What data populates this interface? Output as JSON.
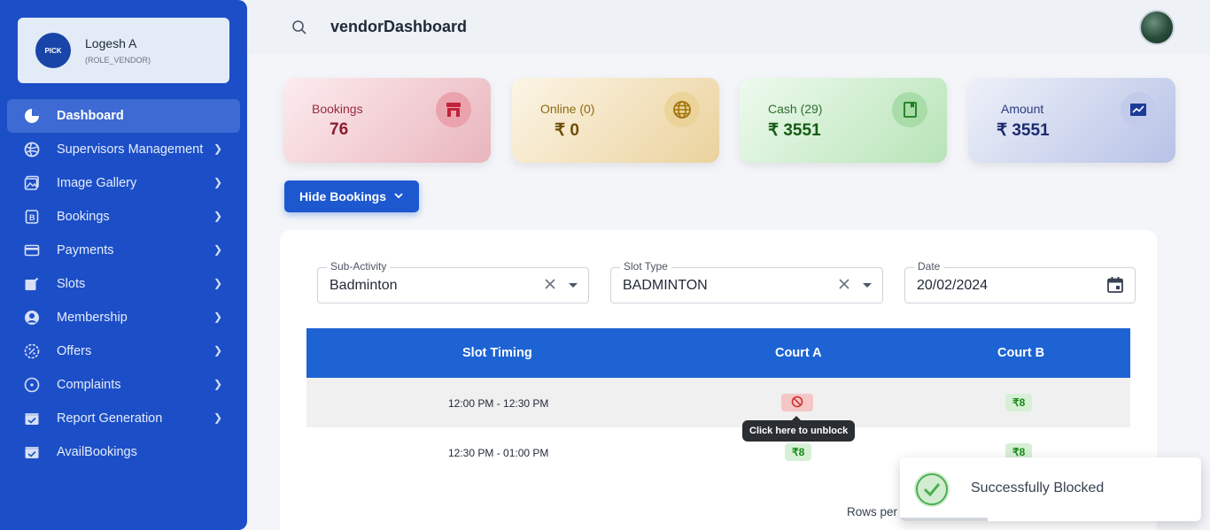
{
  "profile": {
    "name": "Logesh A",
    "role": "(ROLE_VENDOR)",
    "avatar_text": "PICK"
  },
  "nav": [
    {
      "label": "Dashboard",
      "icon": "pie-chart-icon",
      "active": true
    },
    {
      "label": "Supervisors Management",
      "icon": "globe-icon"
    },
    {
      "label": "Image Gallery",
      "icon": "gallery-icon"
    },
    {
      "label": "Bookings",
      "icon": "booking-icon"
    },
    {
      "label": "Payments",
      "icon": "card-icon"
    },
    {
      "label": "Slots",
      "icon": "edit-icon"
    },
    {
      "label": "Membership",
      "icon": "user-circle-icon"
    },
    {
      "label": "Offers",
      "icon": "offer-icon"
    },
    {
      "label": "Complaints",
      "icon": "dot-circle-icon"
    },
    {
      "label": "Report Generation",
      "icon": "calendar-check-icon"
    },
    {
      "label": "AvailBookings",
      "icon": "calendar-icon"
    }
  ],
  "header": {
    "title": "vendorDashboard"
  },
  "cards": [
    {
      "label": "Bookings",
      "value": "76",
      "icon": "store-icon"
    },
    {
      "label": "Online (0)",
      "value": "₹ 0",
      "icon": "globe-icon"
    },
    {
      "label": "Cash (29)",
      "value": "₹ 3551",
      "icon": "book-icon"
    },
    {
      "label": "Amount",
      "value": "₹ 3551",
      "icon": "trend-chart-icon"
    }
  ],
  "hide_bookings_label": "Hide Bookings",
  "filters": {
    "sub_activity": {
      "label": "Sub-Activity",
      "value": "Badminton"
    },
    "slot_type": {
      "label": "Slot Type",
      "value": "BADMINTON"
    },
    "date": {
      "label": "Date",
      "value": "20/02/2024"
    }
  },
  "table": {
    "headers": [
      "Slot Timing",
      "Court A",
      "Court B"
    ],
    "rows": [
      {
        "time": "12:00 PM - 12:30 PM",
        "court_a": "blocked",
        "court_b": "₹8"
      },
      {
        "time": "12:30 PM - 01:00 PM",
        "court_a": "₹8",
        "court_b": "₹8"
      }
    ]
  },
  "tooltip": "Click here to unblock",
  "rows_per_page_label": "Rows per",
  "toast": {
    "message": "Successfully Blocked",
    "progress": 0.29
  },
  "colors": {
    "sidebar": "#1c4fc7",
    "accent": "#1d63d3",
    "success": "#178a17",
    "blocked": "#d32f2f"
  }
}
